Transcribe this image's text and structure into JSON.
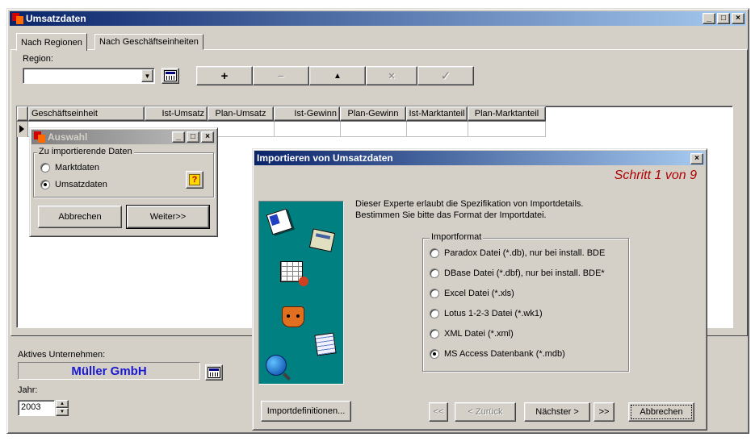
{
  "main": {
    "title": "Umsatzdaten",
    "tabs": [
      "Nach Regionen",
      "Nach Geschäftseinheiten"
    ],
    "region_label": "Region:",
    "region_value": "",
    "toolbar": {
      "add": "+",
      "remove": "−",
      "up": "▲",
      "cancel": "✕",
      "confirm": "✓"
    },
    "table": {
      "columns": [
        "Geschäftseinheit",
        "Ist-Umsatz",
        "Plan-Umsatz",
        "Ist-Gewinn",
        "Plan-Gewinn",
        "Ist-Marktanteil",
        "Plan-Marktanteil"
      ]
    },
    "company_label": "Aktives Unternehmen:",
    "company_value": "Müller GmbH",
    "year_label": "Jahr:",
    "year_value": "2003",
    "colors": {
      "company_text": "#1a1ad0",
      "titlebar": "#0a246a"
    }
  },
  "auswahl": {
    "title": "Auswahl",
    "group_label": "Zu importierende Daten",
    "options": [
      {
        "label": "Marktdaten",
        "selected": false
      },
      {
        "label": "Umsatzdaten",
        "selected": true
      }
    ],
    "help_icon": "?",
    "cancel": "Abbrechen",
    "next": "Weiter>>"
  },
  "import": {
    "title": "Importieren von Umsatzdaten",
    "step": "Schritt 1 von 9",
    "step_color": "#b00000",
    "description_1": "Dieser Experte erlaubt die Spezifikation von Importdetails.",
    "description_2": "Bestimmen Sie bitte das Format der Importdatei.",
    "group_label": "Importformat",
    "formats": [
      {
        "label": "Paradox Datei (*.db), nur bei install. BDE",
        "selected": false
      },
      {
        "label": "DBase Datei (*.dbf), nur bei install. BDE*",
        "selected": false
      },
      {
        "label": "Excel Datei (*.xls)",
        "selected": false
      },
      {
        "label": "Lotus 1-2-3 Datei (*.wk1)",
        "selected": false
      },
      {
        "label": "XML Datei (*.xml)",
        "selected": false
      },
      {
        "label": "MS Access Datenbank (*.mdb)",
        "selected": true
      }
    ],
    "buttons": {
      "definitions": "Importdefinitionen...",
      "first": "<<",
      "back": "< Zurück",
      "next": "Nächster >",
      "last": ">>",
      "cancel": "Abbrechen"
    },
    "panel_color": "#008080"
  }
}
